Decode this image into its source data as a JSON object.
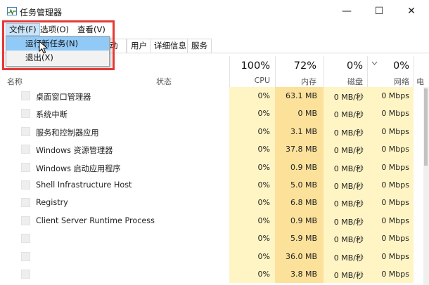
{
  "window": {
    "title": "任务管理器",
    "minimize_glyph": "—",
    "maximize_glyph": "☐",
    "close_glyph": "✕"
  },
  "menu": {
    "file": "文件(F)",
    "options": "选项(O)",
    "view": "查看(V)"
  },
  "file_menu": {
    "items": [
      "运行新任务(N)",
      "退出(X)"
    ]
  },
  "tabs": [
    "动",
    "用户",
    "详细信息",
    "服务"
  ],
  "columns": {
    "name": "名称",
    "status": "状态",
    "cpu": {
      "pct": "100%",
      "label": "CPU"
    },
    "memory": {
      "pct": "72%",
      "label": "内存"
    },
    "disk": {
      "pct": "0%",
      "label": "磁盘"
    },
    "network": {
      "pct": "0%",
      "label": "网络"
    },
    "next_partial": "电"
  },
  "processes": [
    {
      "name": "桌面窗口管理器",
      "cpu": "0%",
      "memory": "63.1 MB",
      "disk": "0 MB/秒",
      "network": "0 Mbps"
    },
    {
      "name": "系统中断",
      "cpu": "0%",
      "memory": "0 MB",
      "disk": "0 MB/秒",
      "network": "0 Mbps"
    },
    {
      "name": "服务和控制器应用",
      "cpu": "0%",
      "memory": "3.1 MB",
      "disk": "0 MB/秒",
      "network": "0 Mbps"
    },
    {
      "name": "Windows 资源管理器",
      "cpu": "0%",
      "memory": "37.8 MB",
      "disk": "0 MB/秒",
      "network": "0 Mbps"
    },
    {
      "name": "Windows 启动应用程序",
      "cpu": "0%",
      "memory": "0.9 MB",
      "disk": "0 MB/秒",
      "network": "0 Mbps"
    },
    {
      "name": "Shell Infrastructure Host",
      "cpu": "0%",
      "memory": "5.0 MB",
      "disk": "0 MB/秒",
      "network": "0 Mbps"
    },
    {
      "name": "Registry",
      "cpu": "0%",
      "memory": "6.8 MB",
      "disk": "0 MB/秒",
      "network": "0 Mbps"
    },
    {
      "name": "Client Server Runtime Process",
      "cpu": "0%",
      "memory": "0.9 MB",
      "disk": "0 MB/秒",
      "network": "0 Mbps"
    },
    {
      "name": "",
      "cpu": "0%",
      "memory": "5.9 MB",
      "disk": "0 MB/秒",
      "network": "0 Mbps"
    },
    {
      "name": "",
      "cpu": "0%",
      "memory": "36.0 MB",
      "disk": "0 MB/秒",
      "network": "0 Mbps"
    },
    {
      "name": "",
      "cpu": "0%",
      "memory": "3.8 MB",
      "disk": "0 MB/秒",
      "network": "0 Mbps"
    }
  ],
  "colors": {
    "highlight_border": "#e53935",
    "menu_selected": "#91c9f7",
    "heat_light": "#fff4c4",
    "heat_medium": "#fce19b"
  },
  "icons": {
    "app": "task-manager-icon",
    "cursor": "mouse-pointer-icon",
    "sort": "chevron-down-icon"
  }
}
